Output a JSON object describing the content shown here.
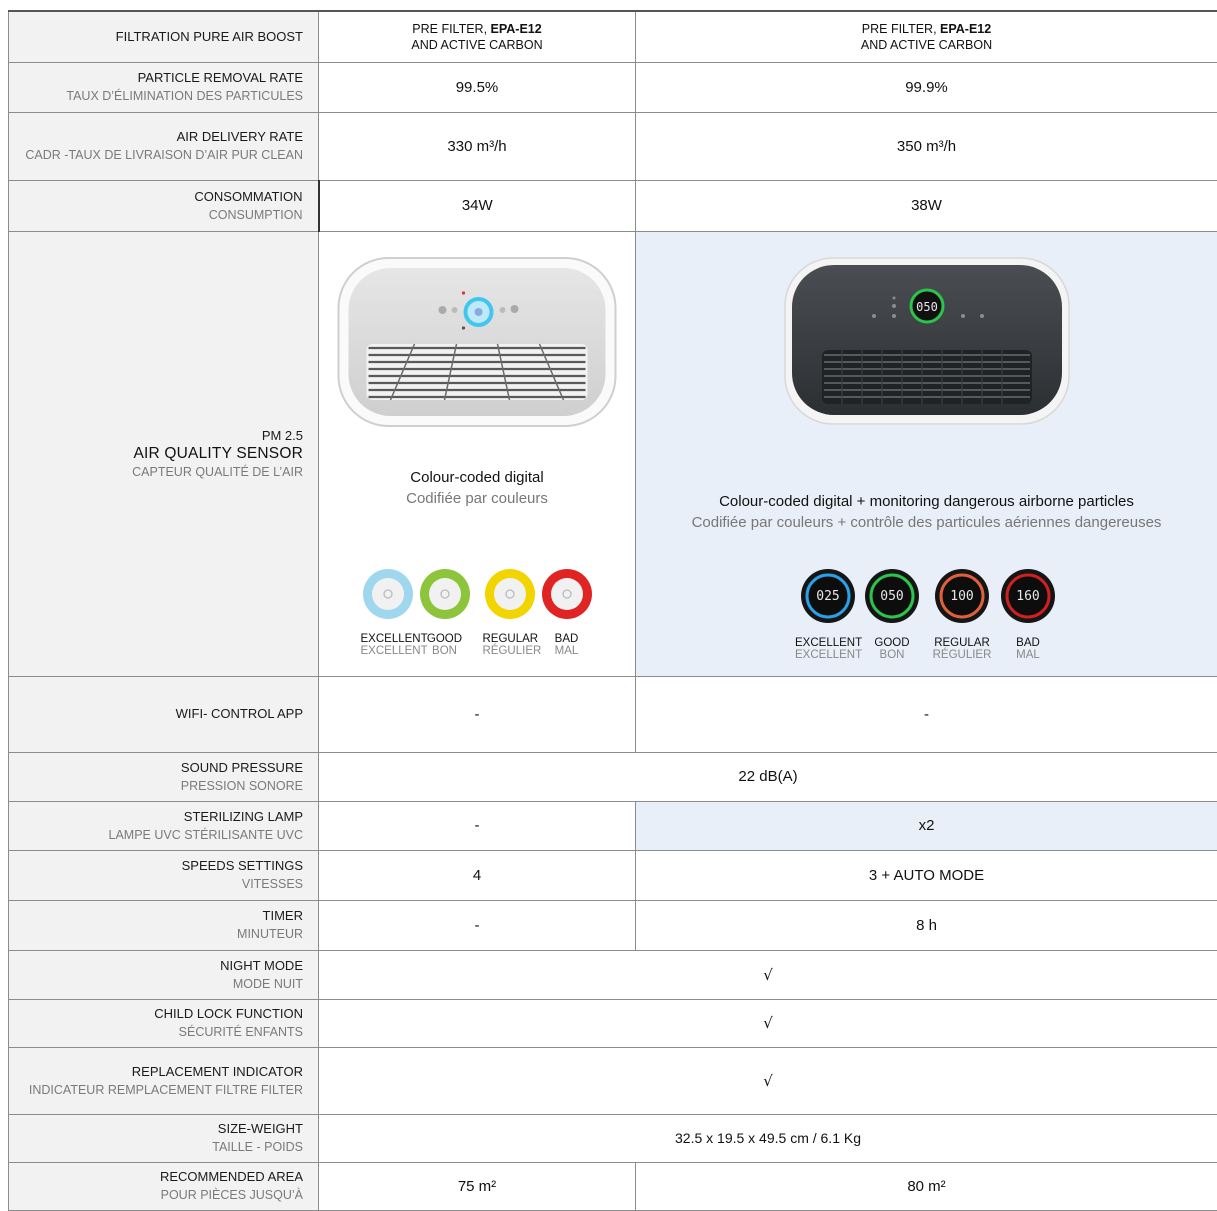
{
  "rows": {
    "filtration": {
      "label": "FILTRATION PURE AIR BOOST",
      "a_pre": "PRE FILTER, ",
      "a_bold": "EPA-E12",
      "a_post": "AND ACTIVE CARBON",
      "b_pre": "PRE FILTER, ",
      "b_bold": "EPA-E12",
      "b_post": "AND ACTIVE CARBON"
    },
    "particle": {
      "label_en": "PARTICLE REMOVAL RATE",
      "label_fr": "TAUX D’ÉLIMINATION DES PARTICULES",
      "a": "99.5%",
      "b": "99.9%"
    },
    "air_delivery": {
      "label_en": "AIR DELIVERY RATE",
      "label_fr": "CADR -TAUX DE LIVRAISON D’AIR PUR CLEAN",
      "a": "330 m³/h",
      "b": "350 m³/h"
    },
    "consumption": {
      "label_en": "CONSOMMATION",
      "label_fr": "CONSUMPTION",
      "a": "34W",
      "b": "38W"
    },
    "sensor": {
      "label_top": "PM 2.5",
      "label_main": "AIR QUALITY SENSOR",
      "label_fr": "CAPTEUR QUALITÉ DE L’AIR",
      "a_desc": "Colour-coded digital",
      "a_desc_fr": "Codifiée par couleurs",
      "b_desc": "Colour-coded digital + monitoring dangerous airborne particles",
      "b_desc_fr": "Codifiée par couleurs + contrôle des particules aériennes dangereuses",
      "b_display": "050",
      "levels": [
        {
          "en": "EXCELLENT",
          "fr": "EXCELLENT",
          "color": "#9fd8ee",
          "value": "025",
          "ring": "#2aa0e6"
        },
        {
          "en": "GOOD",
          "fr": "BON",
          "color": "#8cc43c",
          "value": "050",
          "ring": "#2cc44a"
        },
        {
          "en": "REGULAR",
          "fr": "RÉGULIER",
          "color": "#f2d500",
          "value": "100",
          "ring": "#e0603a"
        },
        {
          "en": "BAD",
          "fr": "MAL",
          "color": "#e02424",
          "value": "160",
          "ring": "#d02020"
        }
      ]
    },
    "wifi": {
      "label": "WIFI-  CONTROL APP",
      "a": "-",
      "b": "-"
    },
    "sound": {
      "label_en": "SOUND PRESSURE",
      "label_fr": "PRESSION SONORE",
      "value": "22 dB(A)"
    },
    "lamp": {
      "label_en": "STERILIZING LAMP",
      "label_fr": "LAMPE UVC STÉRILISANTE UVC",
      "a": "-",
      "b": "x2"
    },
    "speeds": {
      "label_en": "SPEEDS SETTINGS",
      "label_fr": "VITESSES",
      "a": "4",
      "b": "3 + AUTO MODE"
    },
    "timer": {
      "label_en": "TIMER",
      "label_fr": "MINUTEUR",
      "a": "-",
      "b": "8 h"
    },
    "night": {
      "label_en": "NIGHT MODE",
      "label_fr": "MODE NUIT",
      "value": "√"
    },
    "child": {
      "label_en": "CHILD LOCK FUNCTION",
      "label_fr": "SÉCURITÉ ENFANTS",
      "value": "√"
    },
    "replacement": {
      "label_en": "REPLACEMENT INDICATOR",
      "label_fr": "INDICATEUR REMPLACEMENT FILTRE FILTER",
      "value": "√"
    },
    "size": {
      "label_en": "SIZE-WEIGHT",
      "label_fr": "TAILLE - POIDS",
      "value": "32.5 x 19.5 x 49.5 cm / 6.1 Kg"
    },
    "area": {
      "label_en": "RECOMMENDED AREA",
      "label_fr": "POUR PIÈCES JUSQU’À",
      "a": "75 m²",
      "b": "80 m²"
    }
  }
}
